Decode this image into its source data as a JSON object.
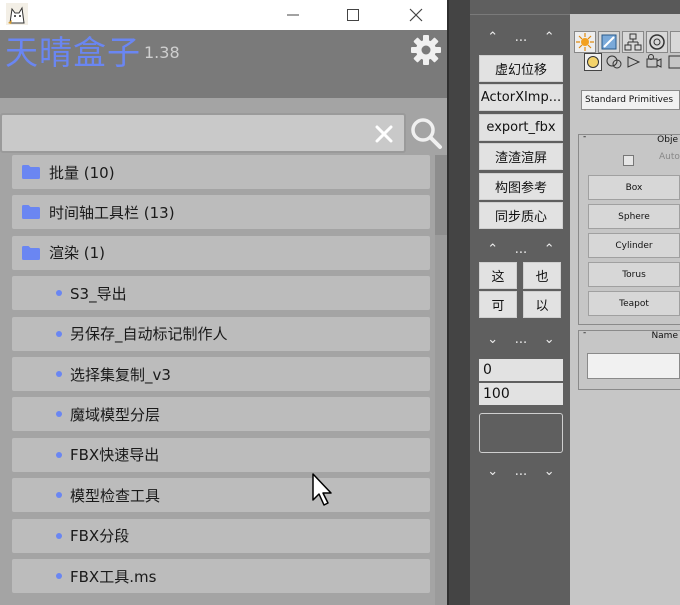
{
  "window": {
    "controls": {
      "minimize": "—",
      "maximize": "☐",
      "close": "✕"
    },
    "app_name": "天晴盒子",
    "version": "1.38",
    "search": {
      "value": "",
      "placeholder": ""
    },
    "tree": [
      {
        "kind": "folder",
        "label": "批量 (10)"
      },
      {
        "kind": "folder",
        "label": "时间轴工具栏 (13)"
      },
      {
        "kind": "folder",
        "label": "渲染 (1)"
      },
      {
        "kind": "item",
        "label": "S3_导出"
      },
      {
        "kind": "item",
        "label": "另保存_自动标记制作人"
      },
      {
        "kind": "item",
        "label": "选择集复制_v3"
      },
      {
        "kind": "item",
        "label": "魔域模型分层"
      },
      {
        "kind": "item",
        "label": "FBX快速导出"
      },
      {
        "kind": "item",
        "label": "模型检查工具"
      },
      {
        "kind": "item",
        "label": "FBX分段"
      },
      {
        "kind": "item",
        "label": "FBX工具.ms"
      }
    ],
    "colors": {
      "accent": "#6a86f2",
      "row_bg": "#bcbcbc",
      "window_bg": "#a4a4a4"
    }
  },
  "toolbar": {
    "buttons": [
      "虚幻位移",
      "ActorXImp...",
      "export_fbx",
      "渣渣渲屏",
      "构图参考",
      "同步质心"
    ],
    "arrows_top": [
      "⌃",
      "...",
      "⌃"
    ],
    "small_buttons": [
      "这",
      "也",
      "可",
      "以"
    ],
    "arrows_mid": [
      "⌄",
      "...",
      "⌄"
    ],
    "field_start": "0",
    "field_end": "100",
    "arrows_bottom": [
      "⌄",
      "...",
      "⌄"
    ]
  },
  "command_panel": {
    "dropdown_value": "Standard Primitives",
    "object_type_title": "Obje",
    "autogrid_label": "Auto",
    "primitives": [
      "Box",
      "Sphere",
      "Cylinder",
      "Torus",
      "Teapot"
    ],
    "name_rollout_title": "Name",
    "rollout_minus": "-"
  }
}
